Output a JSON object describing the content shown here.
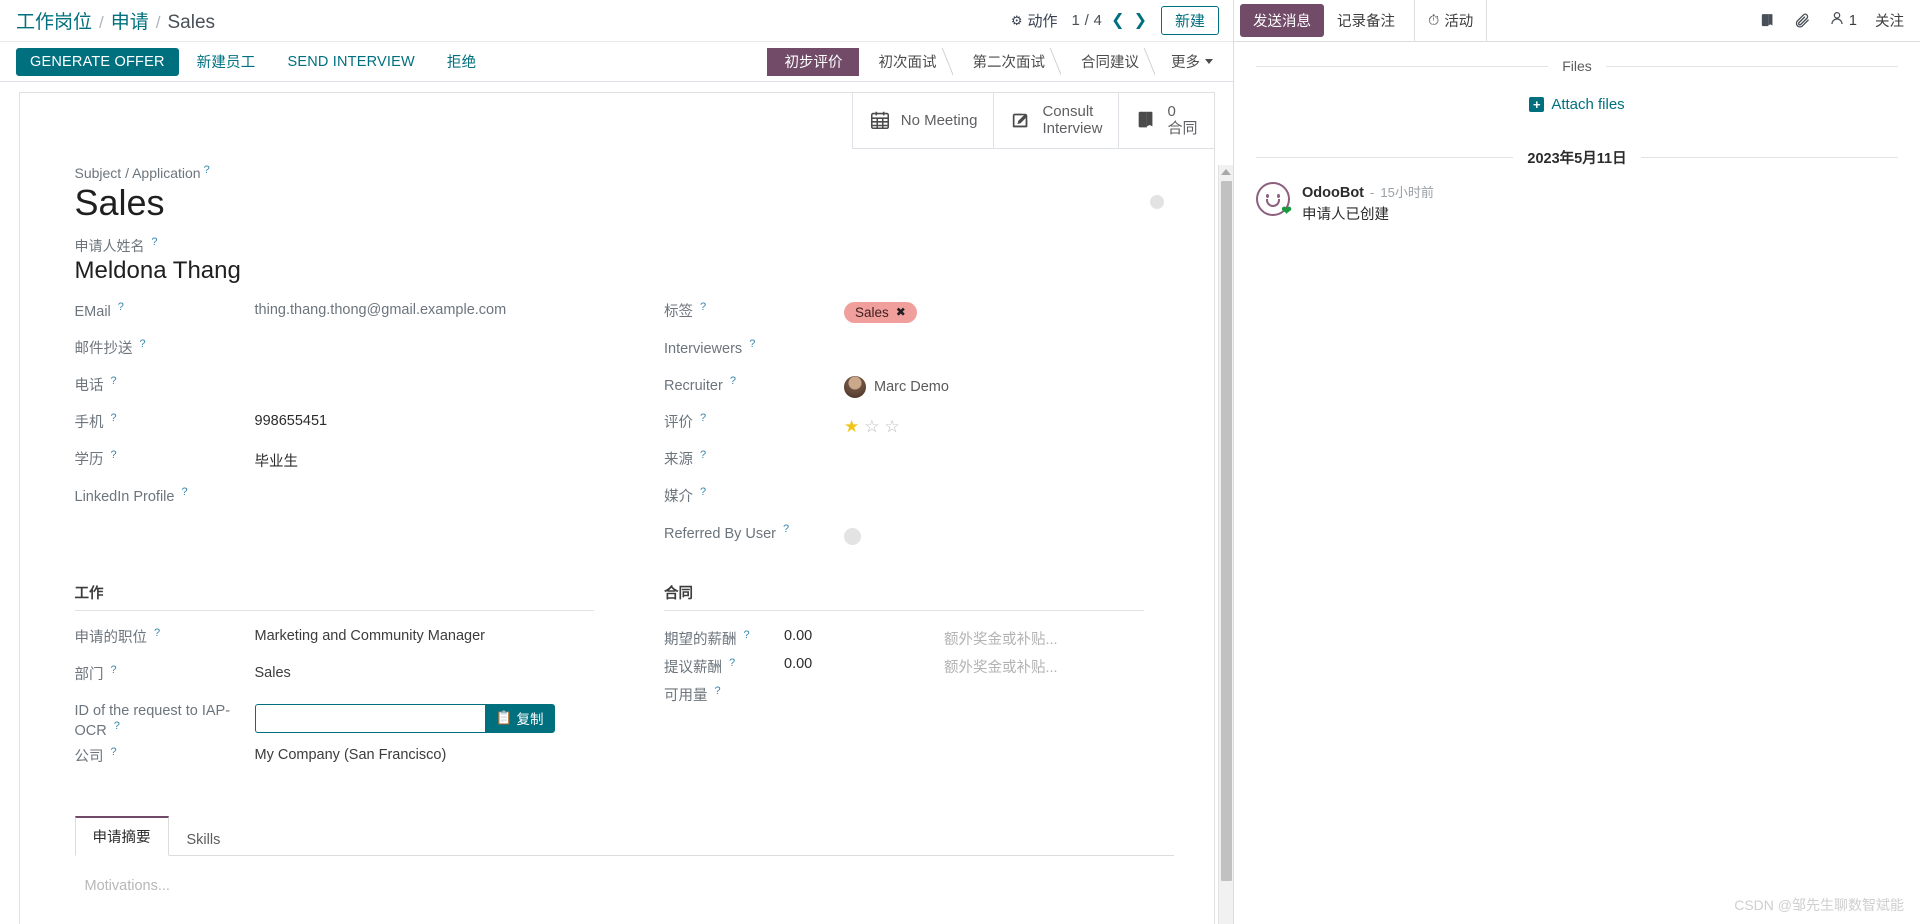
{
  "breadcrumb": {
    "items": [
      "工作岗位",
      "申请"
    ],
    "separator": "/",
    "current": "Sales"
  },
  "control_panel": {
    "action_label": "动作",
    "pager": {
      "value": "1 / 4",
      "prev": "‹",
      "next": "›"
    },
    "new_button": "新建"
  },
  "action_buttons": [
    {
      "label": "GENERATE OFFER",
      "style": "primary"
    },
    {
      "label": "新建员工",
      "style": "link"
    },
    {
      "label": "SEND INTERVIEW",
      "style": "link"
    },
    {
      "label": "拒绝",
      "style": "link"
    }
  ],
  "statusbar": {
    "stages": [
      "初步评价",
      "初次面试",
      "第二次面试",
      "合同建议"
    ],
    "active": "初步评价",
    "more_label": "更多"
  },
  "smart_buttons": [
    {
      "icon": "calendar-icon",
      "label": "No Meeting",
      "value": ""
    },
    {
      "icon": "pencil-square-icon",
      "label": "Consult",
      "value": "Interview"
    },
    {
      "icon": "book-icon",
      "label": "合同",
      "value": "0"
    }
  ],
  "record": {
    "subject_label": "Subject / Application",
    "subject_value": "Sales",
    "applicant_label": "申请人姓名",
    "applicant_value": "Meldona Thang"
  },
  "left_fields": [
    {
      "label": "EMail",
      "value": "thing.thang.thong@gmail.example.com",
      "kind": "mail"
    },
    {
      "label": "邮件抄送",
      "value": "",
      "kind": "text"
    },
    {
      "label": "电话",
      "value": "",
      "kind": "text"
    },
    {
      "label": "手机",
      "value": "998655451",
      "kind": "text"
    },
    {
      "label": "学历",
      "value": "毕业生",
      "kind": "text"
    },
    {
      "label": "LinkedIn Profile",
      "value": "",
      "kind": "text"
    }
  ],
  "right_fields": {
    "tags_label": "标签",
    "tag": {
      "name": "Sales",
      "remove": "✖"
    },
    "interviewers_label": "Interviewers",
    "interviewers_value": "",
    "recruiter_label": "Recruiter",
    "recruiter_value": "Marc Demo",
    "rating_label": "评价",
    "rating_value": 1,
    "rating_max": 3,
    "source_label": "来源",
    "source_value": "",
    "medium_label": "媒介",
    "medium_value": "",
    "referred_label": "Referred By User",
    "referred_value": ""
  },
  "job_group": {
    "title": "工作",
    "rows": [
      {
        "label": "申请的职位",
        "value": "Marketing and Community Manager"
      },
      {
        "label": "部门",
        "value": "Sales"
      }
    ],
    "ocr": {
      "label": "ID of the request to IAP-OCR",
      "value": "",
      "copy_label": "复制"
    },
    "company": {
      "label": "公司",
      "value": "My Company (San Francisco)"
    }
  },
  "contract_group": {
    "title": "合同",
    "rows": [
      {
        "label": "期望的薪酬",
        "value": "0.00",
        "placeholder": "额外奖金或补贴..."
      },
      {
        "label": "提议薪酬",
        "value": "0.00",
        "placeholder": "额外奖金或补贴..."
      }
    ],
    "availability": {
      "label": "可用量",
      "value": ""
    }
  },
  "notebook": {
    "tabs": [
      {
        "label": "申请摘要",
        "active": true
      },
      {
        "label": "Skills",
        "active": false
      }
    ],
    "placeholder": "Motivations..."
  },
  "chatter": {
    "send_message": "发送消息",
    "log_note": "记录备注",
    "activity": "活动",
    "followers_count": "1",
    "follow_label": "关注",
    "files_divider": "Files",
    "attach_label": "Attach files",
    "date_divider": "2023年5月11日",
    "messages": [
      {
        "author": "OdooBot",
        "time": "15小时前",
        "separator": "-",
        "body": "申请人已创建"
      }
    ]
  },
  "watermark": "CSDN @邹先生聊数智斌能",
  "colors": {
    "primary": "#00707f",
    "accent_purple": "#714b67",
    "tag_red": "#f09f9c",
    "star_gold": "#f0c419"
  }
}
